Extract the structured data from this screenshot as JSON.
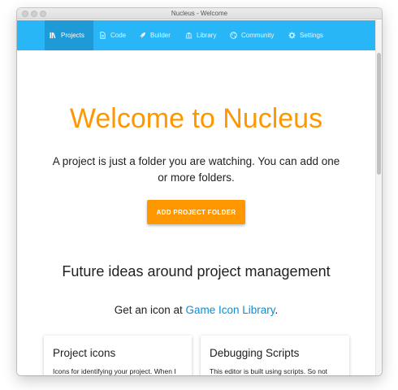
{
  "window": {
    "title": "Nucleus - Welcome"
  },
  "nav": {
    "items": [
      {
        "label": "Projects",
        "icon": "library-icon",
        "active": true
      },
      {
        "label": "Code",
        "icon": "document-icon",
        "active": false
      },
      {
        "label": "Builder",
        "icon": "rocket-icon",
        "active": false
      },
      {
        "label": "Library",
        "icon": "bank-icon",
        "active": false
      },
      {
        "label": "Community",
        "icon": "globe-icon",
        "active": false
      },
      {
        "label": "Settings",
        "icon": "gear-icon",
        "active": false
      }
    ]
  },
  "hero": {
    "title": "Welcome to Nucleus",
    "subtitle": "A project is just a folder you are watching. You can add one or more folders.",
    "button_label": "ADD PROJECT FOLDER"
  },
  "section": {
    "title": "Future ideas around project management",
    "icon_text_prefix": "Get an icon at ",
    "icon_link": "Game Icon Library",
    "icon_text_suffix": "."
  },
  "cards": [
    {
      "title": "Project icons",
      "text": "Icons for identifying your project. When I start out I always miss the initial"
    },
    {
      "title": "Debugging Scripts",
      "text": "This editor is built using scripts. So not only can you change ANYTHING quite"
    }
  ],
  "colors": {
    "nav": "#29b6f6",
    "nav_active": "#1e9ad6",
    "accent": "#ff9800",
    "link": "#0a8fd6"
  }
}
